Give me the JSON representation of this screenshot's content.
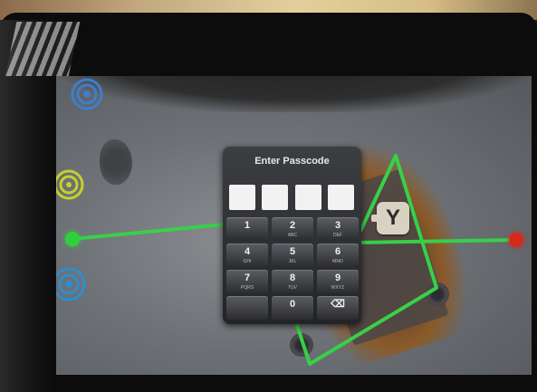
{
  "passcode_dialog": {
    "title": "Enter Passcode",
    "keys": [
      {
        "digit": "1",
        "letters": ""
      },
      {
        "digit": "2",
        "letters": "ABC"
      },
      {
        "digit": "3",
        "letters": "DEF"
      },
      {
        "digit": "4",
        "letters": "GHI"
      },
      {
        "digit": "5",
        "letters": "JKL"
      },
      {
        "digit": "6",
        "letters": "MNO"
      },
      {
        "digit": "7",
        "letters": "PQRS"
      },
      {
        "digit": "8",
        "letters": "TUV"
      },
      {
        "digit": "9",
        "letters": "WXYZ"
      },
      {
        "digit": "",
        "letters": ""
      },
      {
        "digit": "0",
        "letters": ""
      },
      {
        "digit": "⌫",
        "letters": ""
      }
    ]
  },
  "ar_overlay": {
    "y_button_label": "Y",
    "colors": {
      "path_line": "#38d048",
      "node_left": "#2fd03d",
      "node_right": "#d42a1e",
      "spiral_blue_top": "#3c7fd0",
      "spiral_yellow": "#c7cf2e",
      "spiral_blue_bottom": "#2c8fce"
    }
  }
}
